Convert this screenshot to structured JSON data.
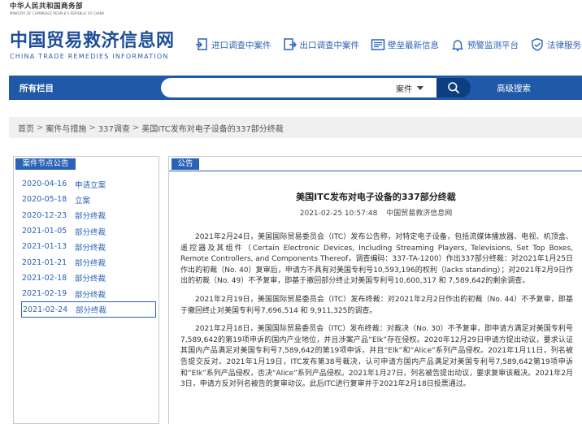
{
  "ministry": {
    "name_cn": "中华人民共和国商务部",
    "name_en": "MINISTRY OF COMMERCE PEOPLE'S REPUBLIC OF CHINA"
  },
  "logo": {
    "title_cn": "中国贸易救济信息网",
    "title_en": "CHINA TRADE REMEDIES INFORMATION"
  },
  "topnav": [
    {
      "label": "进口调查中案件",
      "icon": "import-document-icon"
    },
    {
      "label": "出口调查中案件",
      "icon": "export-document-icon"
    },
    {
      "label": "壁垒最新信息",
      "icon": "barrier-news-icon"
    },
    {
      "label": "预警监测平台",
      "icon": "alert-bell-icon"
    },
    {
      "label": "法律服务平台",
      "icon": "shield-check-icon"
    }
  ],
  "search": {
    "all_columns_label": "所有栏目",
    "input_value": "",
    "select_value": "案件",
    "advanced_label": "高级搜索"
  },
  "breadcrumb": [
    "首页",
    "案件与措施",
    "337调查",
    "美国ITC发布对电子设备的337部分终裁"
  ],
  "sidebar": {
    "heading": "案件节点公告",
    "items": [
      {
        "date": "2020-04-16",
        "label": "申请立案"
      },
      {
        "date": "2020-05-18",
        "label": "立案"
      },
      {
        "date": "2020-12-23",
        "label": "部分终裁"
      },
      {
        "date": "2021-01-05",
        "label": "部分终裁"
      },
      {
        "date": "2021-01-13",
        "label": "部分终裁"
      },
      {
        "date": "2021-01-21",
        "label": "部分终裁"
      },
      {
        "date": "2021-02-18",
        "label": "部分终裁"
      },
      {
        "date": "2021-02-19",
        "label": "部分终裁"
      },
      {
        "date": "2021-02-24",
        "label": "部分终裁"
      }
    ]
  },
  "main": {
    "tab_label": "公告",
    "title": "美国ITC发布对电子设备的337部分终裁",
    "date": "2021-02-25 10:57:48",
    "source": "中国贸易救济信息网",
    "paragraphs": [
      "2021年2月24日，美国国际贸易委员会（ITC）发布公告称，对特定电子设备，包括流媒体播放器、电视、机顶盒、遥控器及其组件（Certain Electronic Devices, Including Streaming Players, Televisions, Set Top Boxes, Remote Controllers, and Components Thereof，调查编码：337-TA-1200）作出337部分终裁：对2021年1月25日作出的初裁（No. 40）复审后，申请方不具有对美国专利号10,593,196的权利（lacks standing）；对2021年2月9日作出的初裁（No. 49）不予复审，即基于撤回部分终止对美国专利号10,600,317 和 7,589,642的剩余调查。",
      "2021年2月19日，美国国际贸易委员会（ITC）发布终裁：对2021年2月2日作出的初裁（No. 44）不予复审，即基于撤回终止对美国专利号7,696,514 和 9,911,325的调查。",
      "2021年2月18日，美国国际贸易委员会（ITC）发布终裁：对裁决（No. 30）不予复审，即申请方满足对美国专利号7,589,642的第19项申诉的国内产业地位，并且涉案产品“Elk”存在侵权。2020年12月29日申请方提出动议，要求认证其国内产品满足对美国专利号7,589,642的第19项申诉，并且“Elk”和“Alice”系列产品侵权。2021年1月11日，列名被告提交反对。2021年1月19日，ITC发布第38号裁决，认可申请方国内产品满足对美国专利号7,589,642第19项申诉和“Elk”系列产品侵权，否决“Alice”系列产品侵权。2021年1月27日，列名被告提出动议，要求复审该裁决。2021年2月3日，申请方反对列名被告的复审动议。此后ITC进行复审并于2021年2月18日投票通过。"
    ]
  },
  "colors": {
    "brand_blue": "#1f59a8",
    "link_blue": "#2a62b5",
    "logo_blue": "#1f4f9a"
  }
}
